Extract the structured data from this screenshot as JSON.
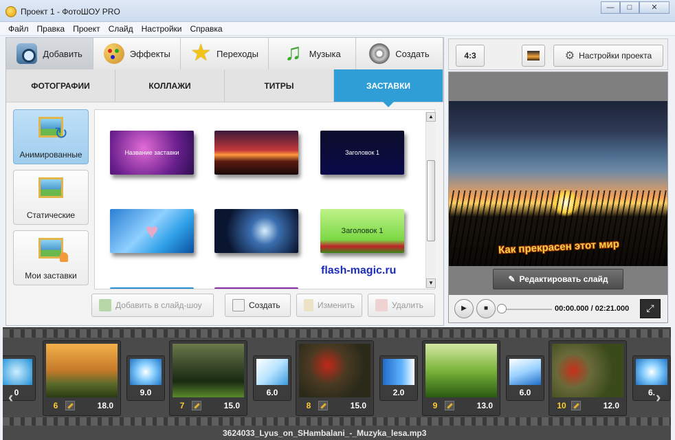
{
  "window": {
    "title": "Проект 1 - ФотоШОУ PRO",
    "min": "—",
    "max": "□",
    "close": "✕"
  },
  "menu": [
    "Файл",
    "Правка",
    "Проект",
    "Слайд",
    "Настройки",
    "Справка"
  ],
  "main_tabs": [
    {
      "label": "Добавить",
      "icon": "camera-icon"
    },
    {
      "label": "Эффекты",
      "icon": "palette-icon"
    },
    {
      "label": "Переходы",
      "icon": "star-icon"
    },
    {
      "label": "Музыка",
      "icon": "music-note-icon"
    },
    {
      "label": "Создать",
      "icon": "disc-icon"
    }
  ],
  "sub_tabs": [
    "ФОТОГРАФИИ",
    "КОЛЛАЖИ",
    "ТИТРЫ",
    "ЗАСТАВКИ"
  ],
  "categories": [
    "Анимированные",
    "Статические",
    "Мои заставки"
  ],
  "gallery": {
    "thumb_texts": [
      "Название заставки",
      "",
      "Заголовок 1",
      "",
      "",
      "Заголовок 1"
    ]
  },
  "watermark": "flash-magic.ru",
  "actions": {
    "add": "Добавить в слайд-шоу",
    "create": "Создать",
    "edit": "Изменить",
    "delete": "Удалить"
  },
  "right": {
    "aspect": "4:3",
    "settings": "Настройки проекта",
    "preview_caption": "Как прекрасен этот мир",
    "edit_slide": "Редактировать слайд",
    "time": "00:00.000 / 02:21.000"
  },
  "timeline": {
    "edge_left_duration": "0",
    "edge_right_duration": "6.",
    "slides": [
      {
        "num": "6",
        "duration": "18.0"
      },
      {
        "num": "7",
        "duration": "15.0"
      },
      {
        "num": "8",
        "duration": "15.0"
      },
      {
        "num": "9",
        "duration": "13.0"
      },
      {
        "num": "10",
        "duration": "12.0"
      }
    ],
    "transitions": [
      "9.0",
      "6.0",
      "2.0",
      "6.0"
    ],
    "audio": "3624033_Lyus_on_SHambalani_-_Muzyka_lesa.mp3"
  }
}
